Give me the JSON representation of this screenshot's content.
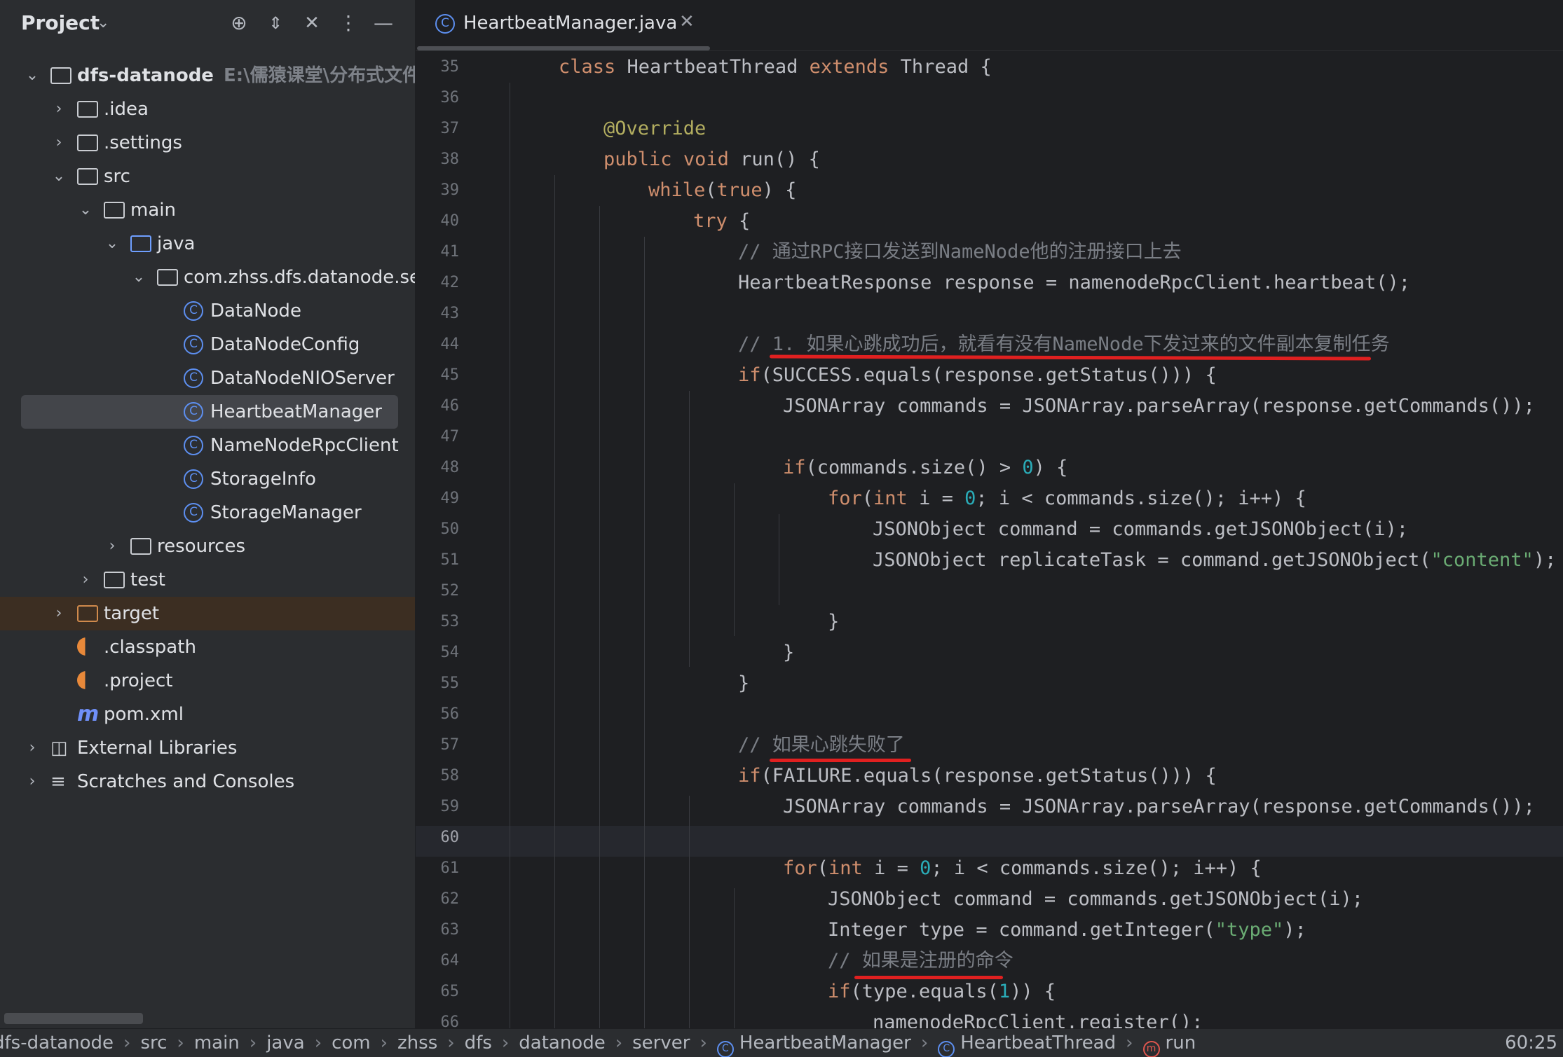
{
  "project_panel": {
    "title": "Project",
    "header_icons": [
      "crosshair-icon",
      "expand-all-icon",
      "collapse-all-icon",
      "more-icon",
      "minimize-icon"
    ],
    "tree": [
      {
        "label": "dfs-datanode",
        "hint": "E:\\儒猿课堂\\分布式文件系",
        "icon": "module-folder-icon",
        "expanded": true
      },
      {
        "label": ".idea",
        "icon": "folder-icon",
        "expanded": false
      },
      {
        "label": ".settings",
        "icon": "folder-icon",
        "expanded": false
      },
      {
        "label": "src",
        "icon": "folder-icon",
        "expanded": true
      },
      {
        "label": "main",
        "icon": "folder-icon",
        "expanded": true
      },
      {
        "label": "java",
        "icon": "source-folder-icon",
        "expanded": true
      },
      {
        "label": "com.zhss.dfs.datanode.server",
        "icon": "package-icon",
        "expanded": true
      },
      {
        "label": "DataNode",
        "icon": "class-icon"
      },
      {
        "label": "DataNodeConfig",
        "icon": "class-icon"
      },
      {
        "label": "DataNodeNIOServer",
        "icon": "class-icon"
      },
      {
        "label": "HeartbeatManager",
        "icon": "class-icon",
        "selected": true
      },
      {
        "label": "NameNodeRpcClient",
        "icon": "class-icon"
      },
      {
        "label": "StorageInfo",
        "icon": "class-icon"
      },
      {
        "label": "StorageManager",
        "icon": "class-icon"
      },
      {
        "label": "resources",
        "icon": "resources-folder-icon",
        "expanded": false
      },
      {
        "label": "test",
        "icon": "folder-icon",
        "expanded": false
      },
      {
        "label": "target",
        "icon": "excluded-folder-icon",
        "expanded": false
      },
      {
        "label": ".classpath",
        "icon": "eclipse-file-icon"
      },
      {
        "label": ".project",
        "icon": "eclipse-file-icon"
      },
      {
        "label": "pom.xml",
        "icon": "maven-icon"
      },
      {
        "label": "External Libraries",
        "icon": "libraries-icon",
        "expanded": false
      },
      {
        "label": "Scratches and Consoles",
        "icon": "scratches-icon",
        "expanded": false
      }
    ]
  },
  "editor": {
    "tab_label": "HeartbeatManager.java",
    "current_line": 60,
    "line_numbers": [
      "35",
      "36",
      "37",
      "38",
      "39",
      "40",
      "41",
      "42",
      "43",
      "44",
      "45",
      "46",
      "47",
      "48",
      "49",
      "50",
      "51",
      "52",
      "53",
      "54",
      "55",
      "56",
      "57",
      "58",
      "59",
      "60",
      "61",
      "62",
      "63",
      "64",
      "65",
      "66"
    ],
    "lines": [
      "class HeartbeatThread extends Thread {",
      "",
      "@Override",
      "public void run() {",
      "while(true) {",
      "try {",
      "// 通过RPC接口发送到NameNode他的注册接口上去",
      "HeartbeatResponse response = namenodeRpcClient.heartbeat();",
      "",
      "// 1. 如果心跳成功后，就看有没有NameNode下发过来的文件副本复制任务",
      "if(SUCCESS.equals(response.getStatus())) {",
      "JSONArray commands = JSONArray.parseArray(response.getCommands());",
      "",
      "if(commands.size() > 0) {",
      "for(int i = 0; i < commands.size(); i++) {",
      "JSONObject command = commands.getJSONObject(i);",
      "JSONObject replicateTask = command.getJSONObject(\"content\");",
      "",
      "}",
      "}",
      "}",
      "",
      "// 如果心跳失败了",
      "if(FAILURE.equals(response.getStatus())) {",
      "JSONArray commands = JSONArray.parseArray(response.getCommands());",
      "",
      "for(int i = 0; i < commands.size(); i++) {",
      "JSONObject command = commands.getJSONObject(i);",
      "Integer type = command.getInteger(\"type\");",
      "// 如果是注册的命令",
      "if(type.equals(1)) {",
      "namenodeRpcClient.register();"
    ],
    "underline_color": "#e02020"
  },
  "status_bar": {
    "breadcrumbs": [
      "dfs-datanode",
      "src",
      "main",
      "java",
      "com",
      "zhss",
      "dfs",
      "datanode",
      "server",
      "HeartbeatManager",
      "HeartbeatThread",
      "run"
    ],
    "caret_position": "60:25"
  },
  "colors": {
    "keyword": "#cf8e6d",
    "number": "#2aacb8",
    "string": "#6aab73",
    "annotation": "#b3ae60",
    "comment": "#7a7e85",
    "default_text": "#bcbec4",
    "class_icon": "#5d8ff0",
    "annotation_underline": "#e02020"
  }
}
